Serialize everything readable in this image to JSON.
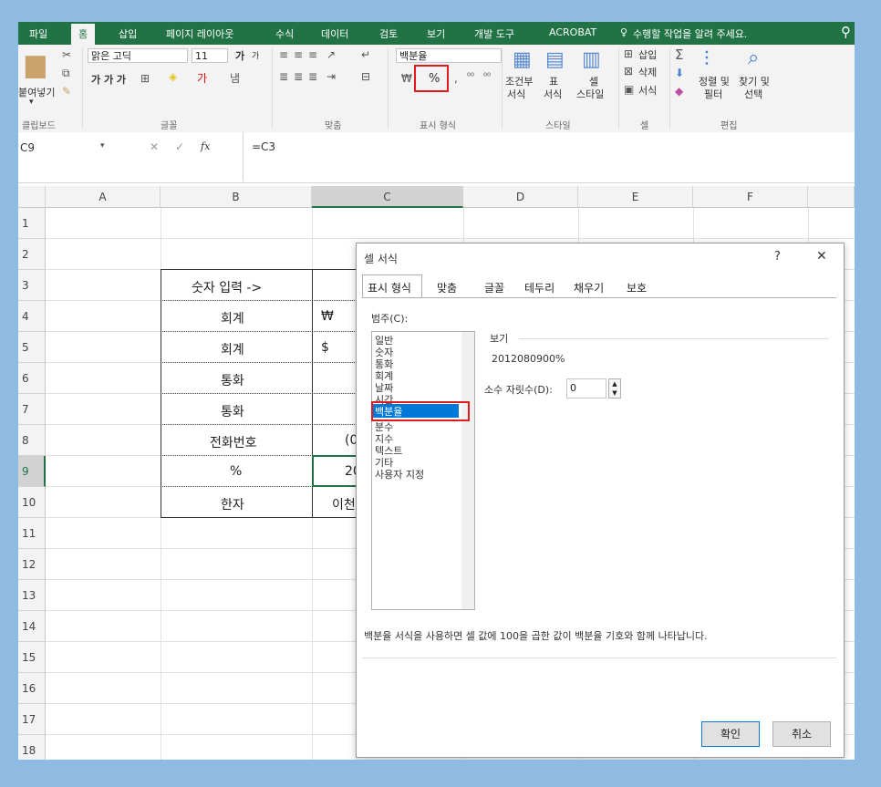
{
  "tabs": [
    "파일",
    "홈",
    "삽입",
    "페이지 레이아웃",
    "수식",
    "데이터",
    "검토",
    "보기",
    "개발 도구",
    "ACROBAT"
  ],
  "tell_me": "수행할 작업을 알려 주세요.",
  "ribbon": {
    "paste": "붙여넣기",
    "font_name": "맑은 고딕",
    "font_size": "11",
    "font_bold_row": "가 가 가",
    "grow_font": "가",
    "shrink_font": "가",
    "number_format": "백분율",
    "percent": "%",
    "cond_format": "조건부",
    "cond_format2": "서식",
    "table_format": "표",
    "table_format2": "서식",
    "cell_style": "셀",
    "cell_style2": "스타일",
    "insert": "삽입",
    "delete": "삭제",
    "format": "서식",
    "sort_filter": "정렬 및",
    "sort_filter2": "필터",
    "find_select": "찾기 및",
    "find_select2": "선택",
    "groups": [
      "클립보드",
      "글꼴",
      "맞춤",
      "표시 형식",
      "스타일",
      "셀",
      "편집"
    ]
  },
  "formula_bar": {
    "cell_ref": "C9",
    "fx": "fx",
    "formula": "=C3"
  },
  "columns": [
    "A",
    "B",
    "C",
    "D",
    "E",
    "F"
  ],
  "rows": [
    "1",
    "2",
    "3",
    "4",
    "5",
    "6",
    "7",
    "8",
    "9",
    "10",
    "11",
    "12",
    "13",
    "14",
    "15",
    "16",
    "17",
    "18"
  ],
  "cells": {
    "b3": "숫자 입력 ->",
    "b4": "회계",
    "b5": "회계",
    "b6": "통화",
    "b7": "통화",
    "b8": "전화번호",
    "b9": "%",
    "b10": "한자",
    "c4": "₩",
    "c5": "$",
    "c8": "(0",
    "c9": "20",
    "c10": "이천"
  },
  "dialog": {
    "title": "셀 서식",
    "help": "?",
    "close": "✕",
    "tabs": [
      "표시 형식",
      "맞춤",
      "글꼴",
      "테두리",
      "채우기",
      "보호"
    ],
    "category_label": "범주(C):",
    "categories": [
      "일반",
      "숫자",
      "통화",
      "회계",
      "날짜",
      "시간",
      "백분율",
      "분수",
      "지수",
      "텍스트",
      "기타",
      "사용자 지정"
    ],
    "selected_category": "백분율",
    "preview_label": "보기",
    "preview_value": "2012080900%",
    "decimal_label": "소수 자릿수(D):",
    "decimal_value": "0",
    "description": "백분율 서식을 사용하면 셀 값에 100을 곱한 값이 백분율 기호와 함께 나타납니다.",
    "ok": "확인",
    "cancel": "취소"
  }
}
